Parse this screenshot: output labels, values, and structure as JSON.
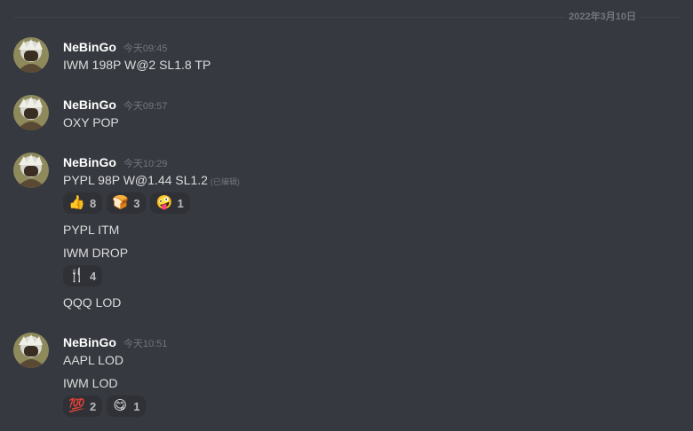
{
  "divider": {
    "date": "2022年3月10日"
  },
  "groups": [
    {
      "username": "NeBinGo",
      "timestamp": "今天09:45",
      "lines": [
        {
          "text": "IWM 198P W@2 SL1.8 TP"
        }
      ]
    },
    {
      "username": "NeBinGo",
      "timestamp": "今天09:57",
      "lines": [
        {
          "text": "OXY POP"
        }
      ]
    },
    {
      "username": "NeBinGo",
      "timestamp": "今天10:29",
      "lines": [
        {
          "text": "PYPL 98P W@1.44 SL1.2",
          "edited": "(已编辑)",
          "reactions": [
            {
              "emoji": "👍",
              "name": "thumbs-up-emoji",
              "count": "8"
            },
            {
              "emoji": "🍞",
              "name": "bread-emoji",
              "count": "3"
            },
            {
              "emoji": "🤪",
              "name": "zany-face-emoji",
              "count": "1"
            }
          ]
        },
        {
          "text": "PYPL ITM"
        },
        {
          "text": "IWM DROP",
          "reactions": [
            {
              "emoji": "🍴",
              "name": "fork-knife-emoji",
              "count": "4"
            }
          ]
        },
        {
          "text": "QQQ LOD"
        }
      ]
    },
    {
      "username": "NeBinGo",
      "timestamp": "今天10:51",
      "lines": [
        {
          "text": "AAPL LOD"
        },
        {
          "text": "IWM LOD",
          "reactions": [
            {
              "emoji": "💯",
              "name": "hundred-points-emoji",
              "count": "2"
            },
            {
              "emoji": "😋",
              "name": "yum-face-emoji",
              "count": "1"
            }
          ]
        }
      ]
    }
  ]
}
